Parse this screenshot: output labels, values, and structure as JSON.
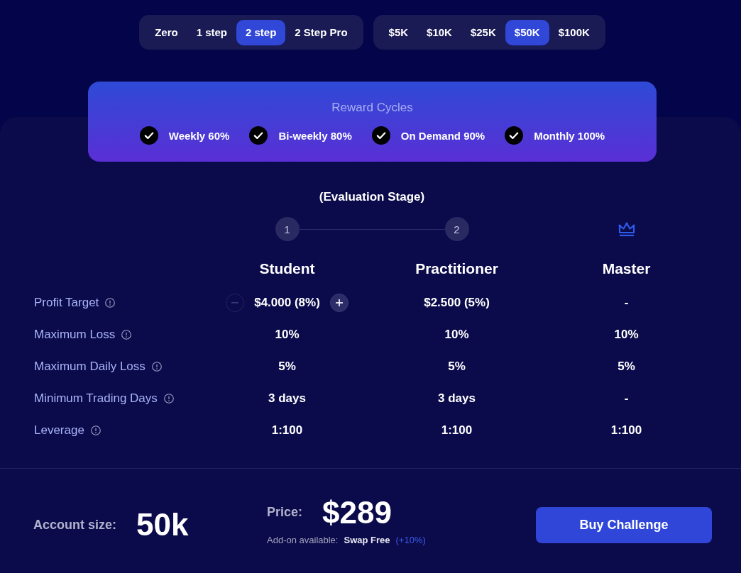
{
  "plan_tabs": [
    {
      "label": "Zero",
      "selected": false
    },
    {
      "label": "1 step",
      "selected": false
    },
    {
      "label": "2 step",
      "selected": true
    },
    {
      "label": "2 Step Pro",
      "selected": false
    }
  ],
  "size_tabs": [
    {
      "label": "$5K",
      "selected": false
    },
    {
      "label": "$10K",
      "selected": false
    },
    {
      "label": "$25K",
      "selected": false
    },
    {
      "label": "$50K",
      "selected": true
    },
    {
      "label": "$100K",
      "selected": false
    }
  ],
  "reward_cycles": {
    "title": "Reward Cycles",
    "items": [
      {
        "label": "Weekly 60%",
        "checked": true
      },
      {
        "label": "Bi-weekly 80%",
        "checked": true
      },
      {
        "label": "On Demand 90%",
        "checked": true
      },
      {
        "label": "Monthly 100%",
        "checked": true
      }
    ]
  },
  "stage_caption": "(Evaluation Stage)",
  "stepper": [
    {
      "kind": "number",
      "label": "1"
    },
    {
      "kind": "number",
      "label": "2"
    },
    {
      "kind": "crown"
    }
  ],
  "columns": [
    "Student",
    "Practitioner",
    "Master"
  ],
  "rows": [
    {
      "label": "Profit Target",
      "kind": "adjustable",
      "decrease_disabled": true,
      "increase_disabled": false,
      "values": [
        "$4.000 (8%)",
        "$2.500 (5%)",
        "-"
      ]
    },
    {
      "label": "Maximum Loss",
      "kind": "plain",
      "values": [
        "10%",
        "10%",
        "10%"
      ]
    },
    {
      "label": "Maximum Daily Loss",
      "kind": "plain",
      "values": [
        "5%",
        "5%",
        "5%"
      ]
    },
    {
      "label": "Minimum Trading Days",
      "kind": "plain",
      "values": [
        "3 days",
        "3 days",
        "-"
      ]
    },
    {
      "label": "Leverage",
      "kind": "plain",
      "values": [
        "1:100",
        "1:100",
        "1:100"
      ]
    }
  ],
  "footer": {
    "account_label": "Account size:",
    "account_value": "50k",
    "price_label": "Price:",
    "price_value": "$289",
    "addon": {
      "label": "Add-on available:",
      "name": "Swap Free",
      "extra": "(+10%)"
    },
    "button": "Buy Challenge"
  }
}
